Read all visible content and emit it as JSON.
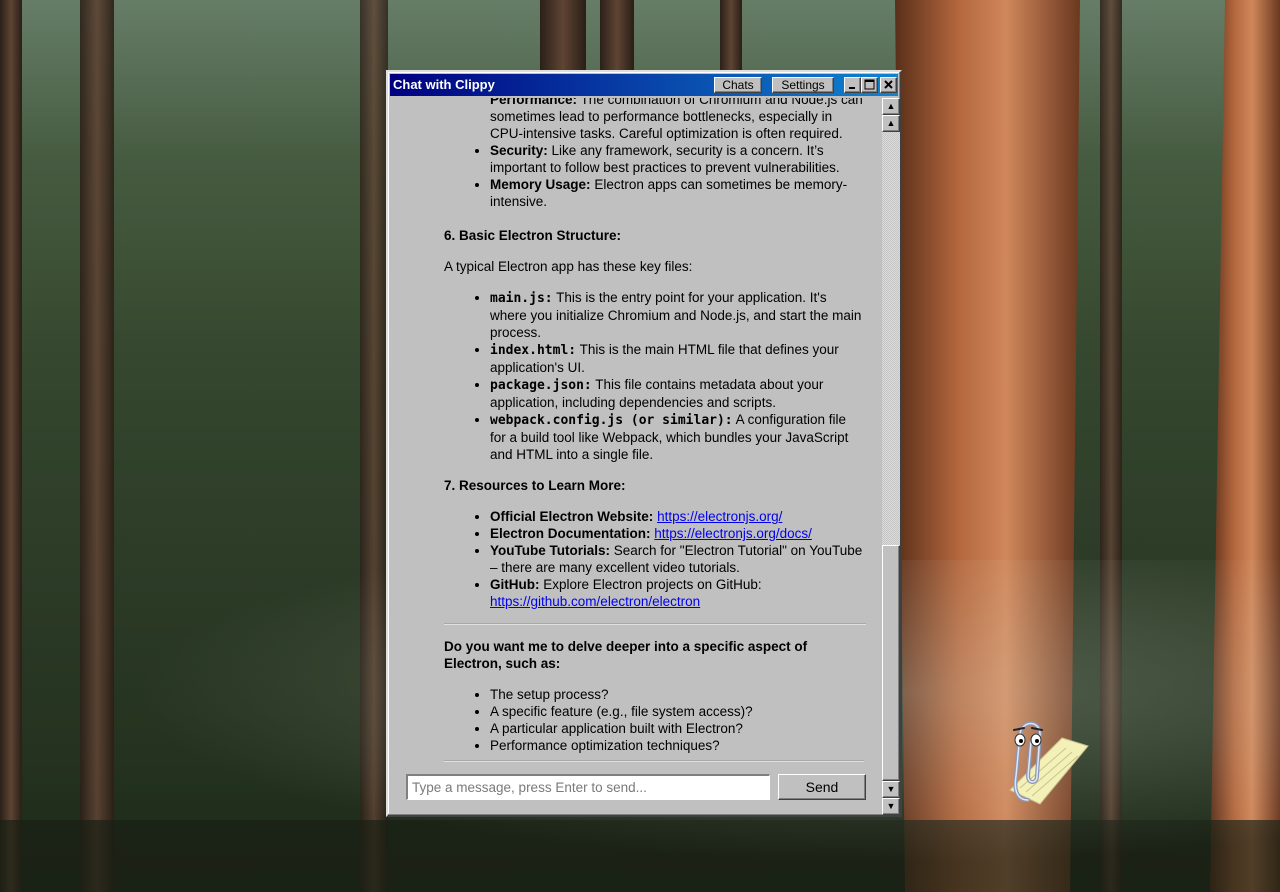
{
  "window": {
    "title": "Chat with Clippy",
    "buttons": {
      "chats": "Chats",
      "settings": "Settings"
    },
    "controls": {
      "minimize": "_",
      "maximize": "□",
      "close": "×"
    }
  },
  "message": {
    "drawbacks": {
      "performance_label": "Performance:",
      "performance_text_top": "The combination of Chromium and Node.js",
      "performance_text": "can sometimes lead to performance bottlenecks, especially in CPU-intensive tasks. Careful optimization is often required.",
      "security_label": "Security:",
      "security_text": "Like any framework, security is a concern. It’s important to follow best practices to prevent vulnerabilities.",
      "memory_label": "Memory Usage:",
      "memory_text": "Electron apps can sometimes be memory-intensive."
    },
    "section6": {
      "heading": "6. Basic Electron Structure:",
      "intro": "A typical Electron app has these key files:",
      "items": [
        {
          "code": "main.js:",
          "text": "This is the entry point for your application. It's where you initialize Chromium and Node.js, and start the main process."
        },
        {
          "code": "index.html:",
          "text": "This is the main HTML file that defines your application's UI."
        },
        {
          "code": "package.json:",
          "text": "This file contains metadata about your application, including dependencies and scripts."
        },
        {
          "code": "webpack.config.js (or similar):",
          "text": "A configuration file for a build tool like Webpack, which bundles your JavaScript and HTML into a single file."
        }
      ]
    },
    "section7": {
      "heading": "7. Resources to Learn More:",
      "website_label": "Official Electron Website:",
      "website_url": "https://electronjs.org/",
      "docs_label": "Electron Documentation:",
      "docs_url": "https://electronjs.org/docs/",
      "youtube_label": "YouTube Tutorials:",
      "youtube_text": "Search for \"Electron Tutorial\" on YouTube – there are many excellent video tutorials.",
      "github_label": "GitHub:",
      "github_text": "Explore Electron projects on GitHub:",
      "github_url": "https://github.com/electron/electron"
    },
    "followup": {
      "question": "Do you want me to delve deeper into a specific aspect of Electron, such as:",
      "options": [
        "The setup process?",
        "A specific feature (e.g., file system access)?",
        "A particular application built with Electron?",
        "Performance optimization techniques?"
      ]
    }
  },
  "composer": {
    "placeholder": "Type a message, press Enter to send...",
    "send_label": "Send"
  },
  "scrollbar": {
    "up_arrow": "▲",
    "down_arrow": "▼"
  },
  "icons": {
    "assistant": "clippy-paperclip-icon"
  }
}
